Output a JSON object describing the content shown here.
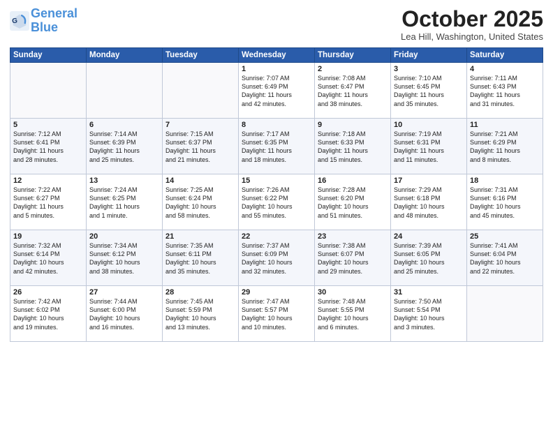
{
  "logo": {
    "line1": "General",
    "line2": "Blue"
  },
  "title": "October 2025",
  "location": "Lea Hill, Washington, United States",
  "days_header": [
    "Sunday",
    "Monday",
    "Tuesday",
    "Wednesday",
    "Thursday",
    "Friday",
    "Saturday"
  ],
  "weeks": [
    [
      {
        "day": "",
        "info": ""
      },
      {
        "day": "",
        "info": ""
      },
      {
        "day": "",
        "info": ""
      },
      {
        "day": "1",
        "info": "Sunrise: 7:07 AM\nSunset: 6:49 PM\nDaylight: 11 hours\nand 42 minutes."
      },
      {
        "day": "2",
        "info": "Sunrise: 7:08 AM\nSunset: 6:47 PM\nDaylight: 11 hours\nand 38 minutes."
      },
      {
        "day": "3",
        "info": "Sunrise: 7:10 AM\nSunset: 6:45 PM\nDaylight: 11 hours\nand 35 minutes."
      },
      {
        "day": "4",
        "info": "Sunrise: 7:11 AM\nSunset: 6:43 PM\nDaylight: 11 hours\nand 31 minutes."
      }
    ],
    [
      {
        "day": "5",
        "info": "Sunrise: 7:12 AM\nSunset: 6:41 PM\nDaylight: 11 hours\nand 28 minutes."
      },
      {
        "day": "6",
        "info": "Sunrise: 7:14 AM\nSunset: 6:39 PM\nDaylight: 11 hours\nand 25 minutes."
      },
      {
        "day": "7",
        "info": "Sunrise: 7:15 AM\nSunset: 6:37 PM\nDaylight: 11 hours\nand 21 minutes."
      },
      {
        "day": "8",
        "info": "Sunrise: 7:17 AM\nSunset: 6:35 PM\nDaylight: 11 hours\nand 18 minutes."
      },
      {
        "day": "9",
        "info": "Sunrise: 7:18 AM\nSunset: 6:33 PM\nDaylight: 11 hours\nand 15 minutes."
      },
      {
        "day": "10",
        "info": "Sunrise: 7:19 AM\nSunset: 6:31 PM\nDaylight: 11 hours\nand 11 minutes."
      },
      {
        "day": "11",
        "info": "Sunrise: 7:21 AM\nSunset: 6:29 PM\nDaylight: 11 hours\nand 8 minutes."
      }
    ],
    [
      {
        "day": "12",
        "info": "Sunrise: 7:22 AM\nSunset: 6:27 PM\nDaylight: 11 hours\nand 5 minutes."
      },
      {
        "day": "13",
        "info": "Sunrise: 7:24 AM\nSunset: 6:25 PM\nDaylight: 11 hours\nand 1 minute."
      },
      {
        "day": "14",
        "info": "Sunrise: 7:25 AM\nSunset: 6:24 PM\nDaylight: 10 hours\nand 58 minutes."
      },
      {
        "day": "15",
        "info": "Sunrise: 7:26 AM\nSunset: 6:22 PM\nDaylight: 10 hours\nand 55 minutes."
      },
      {
        "day": "16",
        "info": "Sunrise: 7:28 AM\nSunset: 6:20 PM\nDaylight: 10 hours\nand 51 minutes."
      },
      {
        "day": "17",
        "info": "Sunrise: 7:29 AM\nSunset: 6:18 PM\nDaylight: 10 hours\nand 48 minutes."
      },
      {
        "day": "18",
        "info": "Sunrise: 7:31 AM\nSunset: 6:16 PM\nDaylight: 10 hours\nand 45 minutes."
      }
    ],
    [
      {
        "day": "19",
        "info": "Sunrise: 7:32 AM\nSunset: 6:14 PM\nDaylight: 10 hours\nand 42 minutes."
      },
      {
        "day": "20",
        "info": "Sunrise: 7:34 AM\nSunset: 6:12 PM\nDaylight: 10 hours\nand 38 minutes."
      },
      {
        "day": "21",
        "info": "Sunrise: 7:35 AM\nSunset: 6:11 PM\nDaylight: 10 hours\nand 35 minutes."
      },
      {
        "day": "22",
        "info": "Sunrise: 7:37 AM\nSunset: 6:09 PM\nDaylight: 10 hours\nand 32 minutes."
      },
      {
        "day": "23",
        "info": "Sunrise: 7:38 AM\nSunset: 6:07 PM\nDaylight: 10 hours\nand 29 minutes."
      },
      {
        "day": "24",
        "info": "Sunrise: 7:39 AM\nSunset: 6:05 PM\nDaylight: 10 hours\nand 25 minutes."
      },
      {
        "day": "25",
        "info": "Sunrise: 7:41 AM\nSunset: 6:04 PM\nDaylight: 10 hours\nand 22 minutes."
      }
    ],
    [
      {
        "day": "26",
        "info": "Sunrise: 7:42 AM\nSunset: 6:02 PM\nDaylight: 10 hours\nand 19 minutes."
      },
      {
        "day": "27",
        "info": "Sunrise: 7:44 AM\nSunset: 6:00 PM\nDaylight: 10 hours\nand 16 minutes."
      },
      {
        "day": "28",
        "info": "Sunrise: 7:45 AM\nSunset: 5:59 PM\nDaylight: 10 hours\nand 13 minutes."
      },
      {
        "day": "29",
        "info": "Sunrise: 7:47 AM\nSunset: 5:57 PM\nDaylight: 10 hours\nand 10 minutes."
      },
      {
        "day": "30",
        "info": "Sunrise: 7:48 AM\nSunset: 5:55 PM\nDaylight: 10 hours\nand 6 minutes."
      },
      {
        "day": "31",
        "info": "Sunrise: 7:50 AM\nSunset: 5:54 PM\nDaylight: 10 hours\nand 3 minutes."
      },
      {
        "day": "",
        "info": ""
      }
    ]
  ]
}
